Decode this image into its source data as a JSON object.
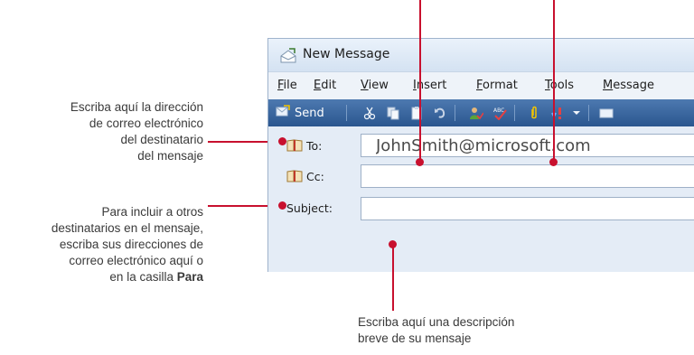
{
  "callouts": {
    "to_line1": "Escriba aquí la dirección",
    "to_line2": "de correo electrónico",
    "to_line3": "del destinatario",
    "to_line4": "del mensaje",
    "cc_line1": "Para incluir a otros",
    "cc_line2": "destinatarios en el mensaje,",
    "cc_line3": "escriba sus direcciones de",
    "cc_line4": "correo electrónico aquí o",
    "cc_line5_prefix": "en la casilla ",
    "cc_line5_bold": "Para",
    "subject_line1": "Escriba aquí una descripción",
    "subject_line2": "breve de su mensaje"
  },
  "window": {
    "title": "New Message"
  },
  "menu": [
    {
      "u": "F",
      "rest": "ile"
    },
    {
      "u": "E",
      "rest": "dit"
    },
    {
      "u": "V",
      "rest": "iew"
    },
    {
      "u": "I",
      "rest": "nsert"
    },
    {
      "u": "F",
      "pre": "",
      "rest": "ormat",
      "underline_index": 1
    },
    {
      "u": "T",
      "rest": "ools"
    },
    {
      "u": "M",
      "rest": "essage"
    }
  ],
  "toolbar": {
    "send_label": "Send"
  },
  "fields": {
    "to_label": "To:",
    "to_value": "JohnSmith@microsoft.com",
    "cc_label": "Cc:",
    "cc_value": "",
    "subject_label": "Subject:",
    "subject_value": ""
  },
  "colors": {
    "accent": "#c8102e",
    "toolbar": "#2a568f"
  }
}
